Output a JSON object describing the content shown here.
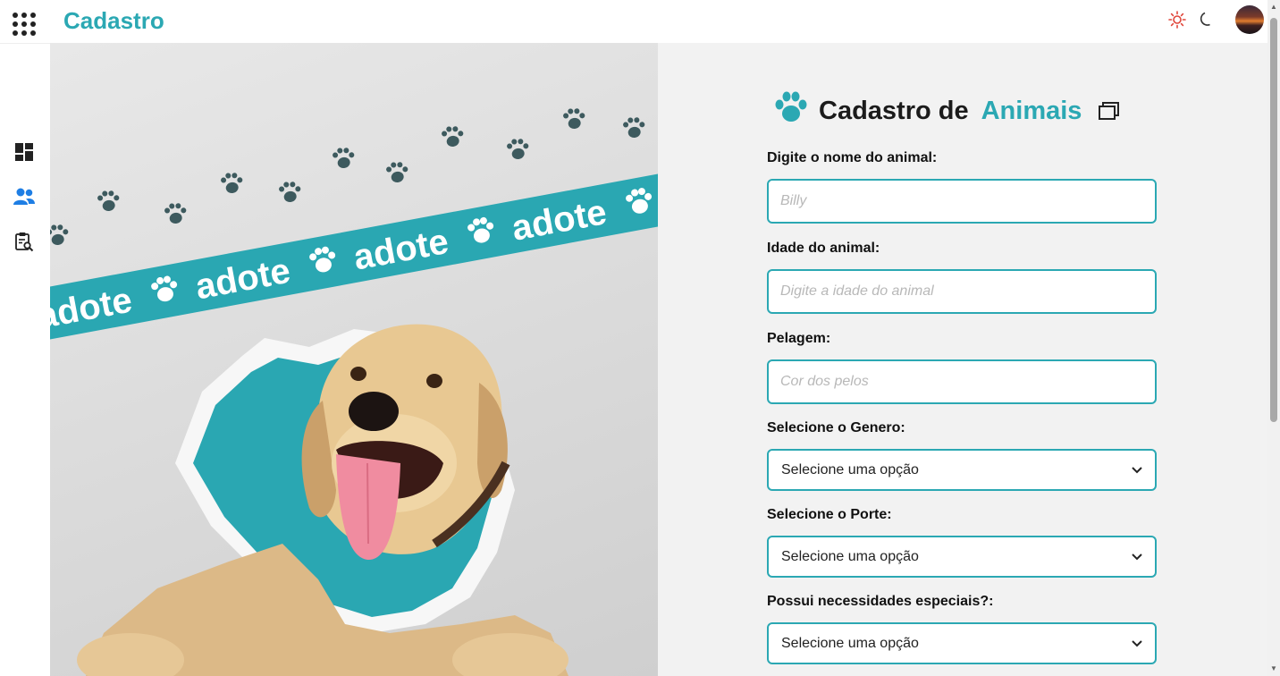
{
  "app": {
    "title": "Cadastro"
  },
  "header": {
    "theme_light_icon": "sun-icon",
    "theme_dark_icon": "moon-icon",
    "avatar_icon": "user-avatar"
  },
  "sidebar": {
    "items": [
      {
        "icon": "dashboard-icon"
      },
      {
        "icon": "users-icon"
      },
      {
        "icon": "clipboard-search-icon"
      }
    ]
  },
  "hero": {
    "banner_text": "adote"
  },
  "form": {
    "title_part1": "Cadastro de",
    "title_part2": "Animais",
    "fields": {
      "name": {
        "label": "Digite o nome do animal:",
        "placeholder": "Billy"
      },
      "age": {
        "label": "Idade do animal:",
        "placeholder": "Digite a idade do animal"
      },
      "coat": {
        "label": "Pelagem:",
        "placeholder": "Cor dos pelos"
      },
      "gender": {
        "label": "Selecione o Genero:",
        "selected": "Selecione uma opção"
      },
      "size": {
        "label": "Selecione o Porte:",
        "selected": "Selecione uma opção"
      },
      "special": {
        "label": "Possui necessidades especiais?:",
        "selected": "Selecione uma opção"
      }
    }
  },
  "colors": {
    "accent": "#2ba8b3",
    "panel_bg": "#f2f2f2",
    "sun": "#e0453a"
  }
}
